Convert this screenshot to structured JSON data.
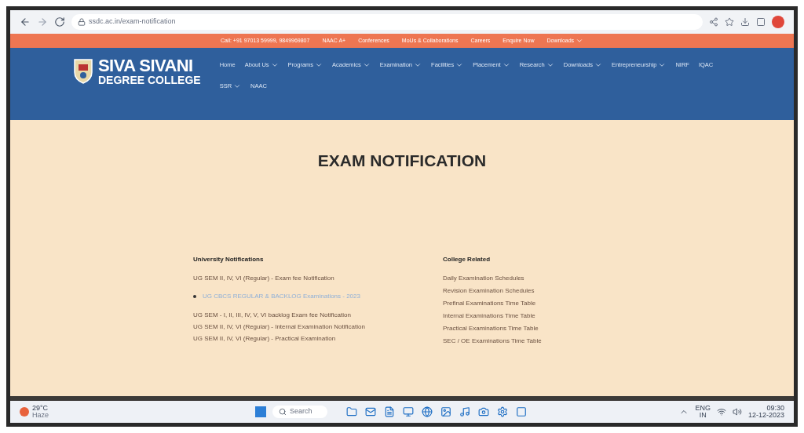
{
  "browser": {
    "url": "ssdc.ac.in/exam-notification"
  },
  "top_bar": {
    "items": [
      {
        "label": "Call: +91 97013 59999, 9849969807",
        "dropdown": false
      },
      {
        "label": "NAAC A+",
        "dropdown": false
      },
      {
        "label": "Conferences",
        "dropdown": false
      },
      {
        "label": "MoUs & Collaborations",
        "dropdown": false
      },
      {
        "label": "Careers",
        "dropdown": false
      },
      {
        "label": "Enquire Now",
        "dropdown": false
      },
      {
        "label": "Downloads",
        "dropdown": true
      }
    ]
  },
  "header": {
    "logo_line_1": "SIVA SIVANI",
    "logo_line_2": "DEGREE COLLEGE",
    "nav": [
      {
        "label": "Home",
        "dropdown": false
      },
      {
        "label": "About Us",
        "dropdown": true
      },
      {
        "label": "Programs",
        "dropdown": true
      },
      {
        "label": "Academics",
        "dropdown": true
      },
      {
        "label": "Examination",
        "dropdown": true
      },
      {
        "label": "Facilities",
        "dropdown": true
      },
      {
        "label": "Placement",
        "dropdown": true
      },
      {
        "label": "Research",
        "dropdown": true
      },
      {
        "label": "Downloads",
        "dropdown": true
      },
      {
        "label": "Entrepreneurship",
        "dropdown": true
      },
      {
        "label": "NIRF",
        "dropdown": false
      },
      {
        "label": "IQAC",
        "dropdown": false
      },
      {
        "label": "SSR",
        "dropdown": true
      },
      {
        "label": "NAAC",
        "dropdown": false
      }
    ]
  },
  "page_title": "EXAM NOTIFICATION",
  "columns": [
    {
      "heading": "University Notifications",
      "items": [
        {
          "kind": "text",
          "text": "UG SEM II, IV, VI (Regular) - Exam fee Notification"
        },
        {
          "kind": "link",
          "text": "UG CBCS REGULAR & BACKLOG Examinations - 2023"
        },
        {
          "kind": "text",
          "text": "UG SEM - I, II, III, IV, V, VI backlog Exam fee Notification"
        },
        {
          "kind": "text",
          "text": "UG SEM II, IV, VI (Regular) - Internal Examination Notification"
        },
        {
          "kind": "text",
          "text": "UG SEM II, IV, VI (Regular) - Practical Examination"
        }
      ]
    },
    {
      "heading": "College Related",
      "items": [
        {
          "kind": "text",
          "text": "Daily Examination Schedules"
        },
        {
          "kind": "text",
          "text": "Revision Examination Schedules"
        },
        {
          "kind": "text",
          "text": "Prefinal Examinations Time Table"
        },
        {
          "kind": "text",
          "text": "Internal Examinations Time Table"
        },
        {
          "kind": "text",
          "text": "Practical Examinations Time Table"
        },
        {
          "kind": "text",
          "text": "SEC / OE Examinations Time Table"
        }
      ]
    }
  ],
  "taskbar": {
    "weather_temp": "29°C",
    "weather_text": "Haze",
    "search": "Search",
    "lang_1": "ENG",
    "lang_2": "IN",
    "time": "09:30",
    "date": "12-12-2023"
  }
}
